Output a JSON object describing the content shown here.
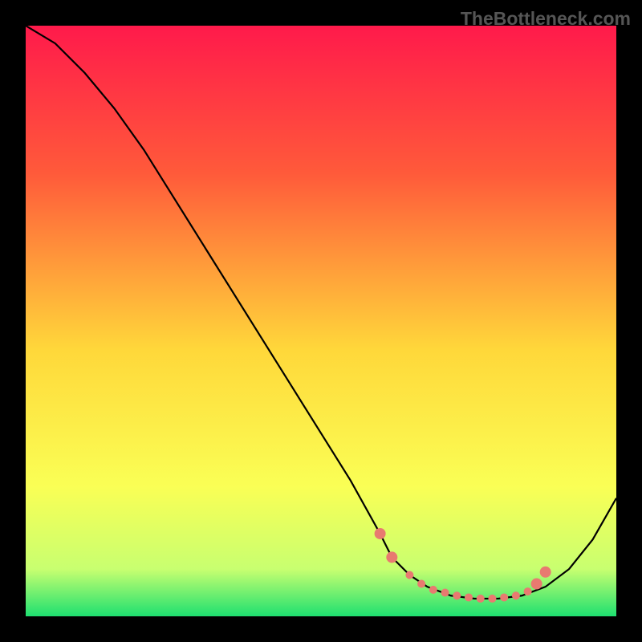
{
  "watermark": "TheBottleneck.com",
  "chart_data": {
    "type": "line",
    "title": "",
    "xlabel": "",
    "ylabel": "",
    "xlim": [
      0,
      100
    ],
    "ylim": [
      0,
      100
    ],
    "background": {
      "type": "vertical-gradient",
      "stops": [
        {
          "pos": 0.0,
          "color": "#ff1a4b"
        },
        {
          "pos": 0.25,
          "color": "#ff5a3a"
        },
        {
          "pos": 0.55,
          "color": "#ffd83a"
        },
        {
          "pos": 0.78,
          "color": "#faff55"
        },
        {
          "pos": 0.92,
          "color": "#c8ff70"
        },
        {
          "pos": 1.0,
          "color": "#1ee070"
        }
      ]
    },
    "series": [
      {
        "name": "curve",
        "color": "#000000",
        "x": [
          0,
          5,
          10,
          15,
          20,
          25,
          30,
          35,
          40,
          45,
          50,
          55,
          60,
          62,
          65,
          68,
          72,
          76,
          80,
          84,
          88,
          92,
          96,
          100
        ],
        "y": [
          100,
          97,
          92,
          86,
          79,
          71,
          63,
          55,
          47,
          39,
          31,
          23,
          14,
          10,
          7,
          5,
          3.5,
          3,
          3,
          3.5,
          5,
          8,
          13,
          20
        ]
      }
    ],
    "markers": {
      "color": "#e87a70",
      "radius_small": 5,
      "radius_large": 7,
      "points": [
        {
          "x": 60,
          "y": 14,
          "r": 7
        },
        {
          "x": 62,
          "y": 10,
          "r": 7
        },
        {
          "x": 65,
          "y": 7,
          "r": 5
        },
        {
          "x": 67,
          "y": 5.5,
          "r": 5
        },
        {
          "x": 69,
          "y": 4.5,
          "r": 5
        },
        {
          "x": 71,
          "y": 4,
          "r": 5
        },
        {
          "x": 73,
          "y": 3.5,
          "r": 5
        },
        {
          "x": 75,
          "y": 3.2,
          "r": 5
        },
        {
          "x": 77,
          "y": 3,
          "r": 5
        },
        {
          "x": 79,
          "y": 3,
          "r": 5
        },
        {
          "x": 81,
          "y": 3.2,
          "r": 5
        },
        {
          "x": 83,
          "y": 3.5,
          "r": 5
        },
        {
          "x": 85,
          "y": 4.2,
          "r": 5
        },
        {
          "x": 86.5,
          "y": 5.5,
          "r": 7
        },
        {
          "x": 88,
          "y": 7.5,
          "r": 7
        }
      ]
    }
  }
}
